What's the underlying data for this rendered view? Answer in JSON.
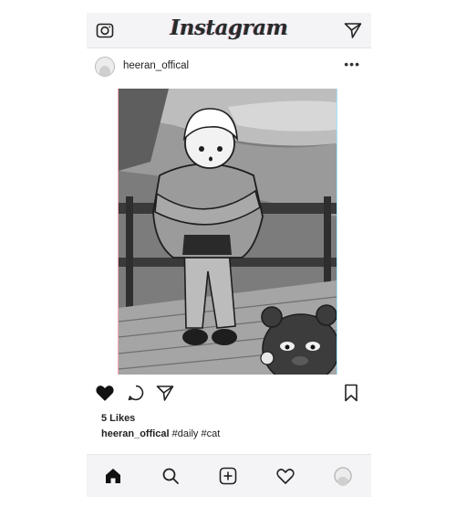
{
  "app": {
    "logo_text": "Instagram"
  },
  "header": {
    "left_icon": "camera-icon",
    "right_icon": "send-icon"
  },
  "post": {
    "username": "heeran_offical",
    "more_label": "•••",
    "image_description_icon": "post-photo",
    "likes_text": "5 Likes",
    "caption_user": "heeran_offical",
    "caption_text": "#daily #cat",
    "liked": true
  },
  "actions": {
    "icons": [
      "heart-filled-icon",
      "comment-icon",
      "share-icon",
      "bookmark-icon"
    ]
  },
  "bottom_nav": {
    "icons": [
      "home-icon",
      "search-icon",
      "add-post-icon",
      "activity-heart-icon",
      "profile-avatar-icon"
    ]
  },
  "colors": {
    "bar_background": "#f4f4f6",
    "icon": "#222222",
    "text": "#222222"
  }
}
